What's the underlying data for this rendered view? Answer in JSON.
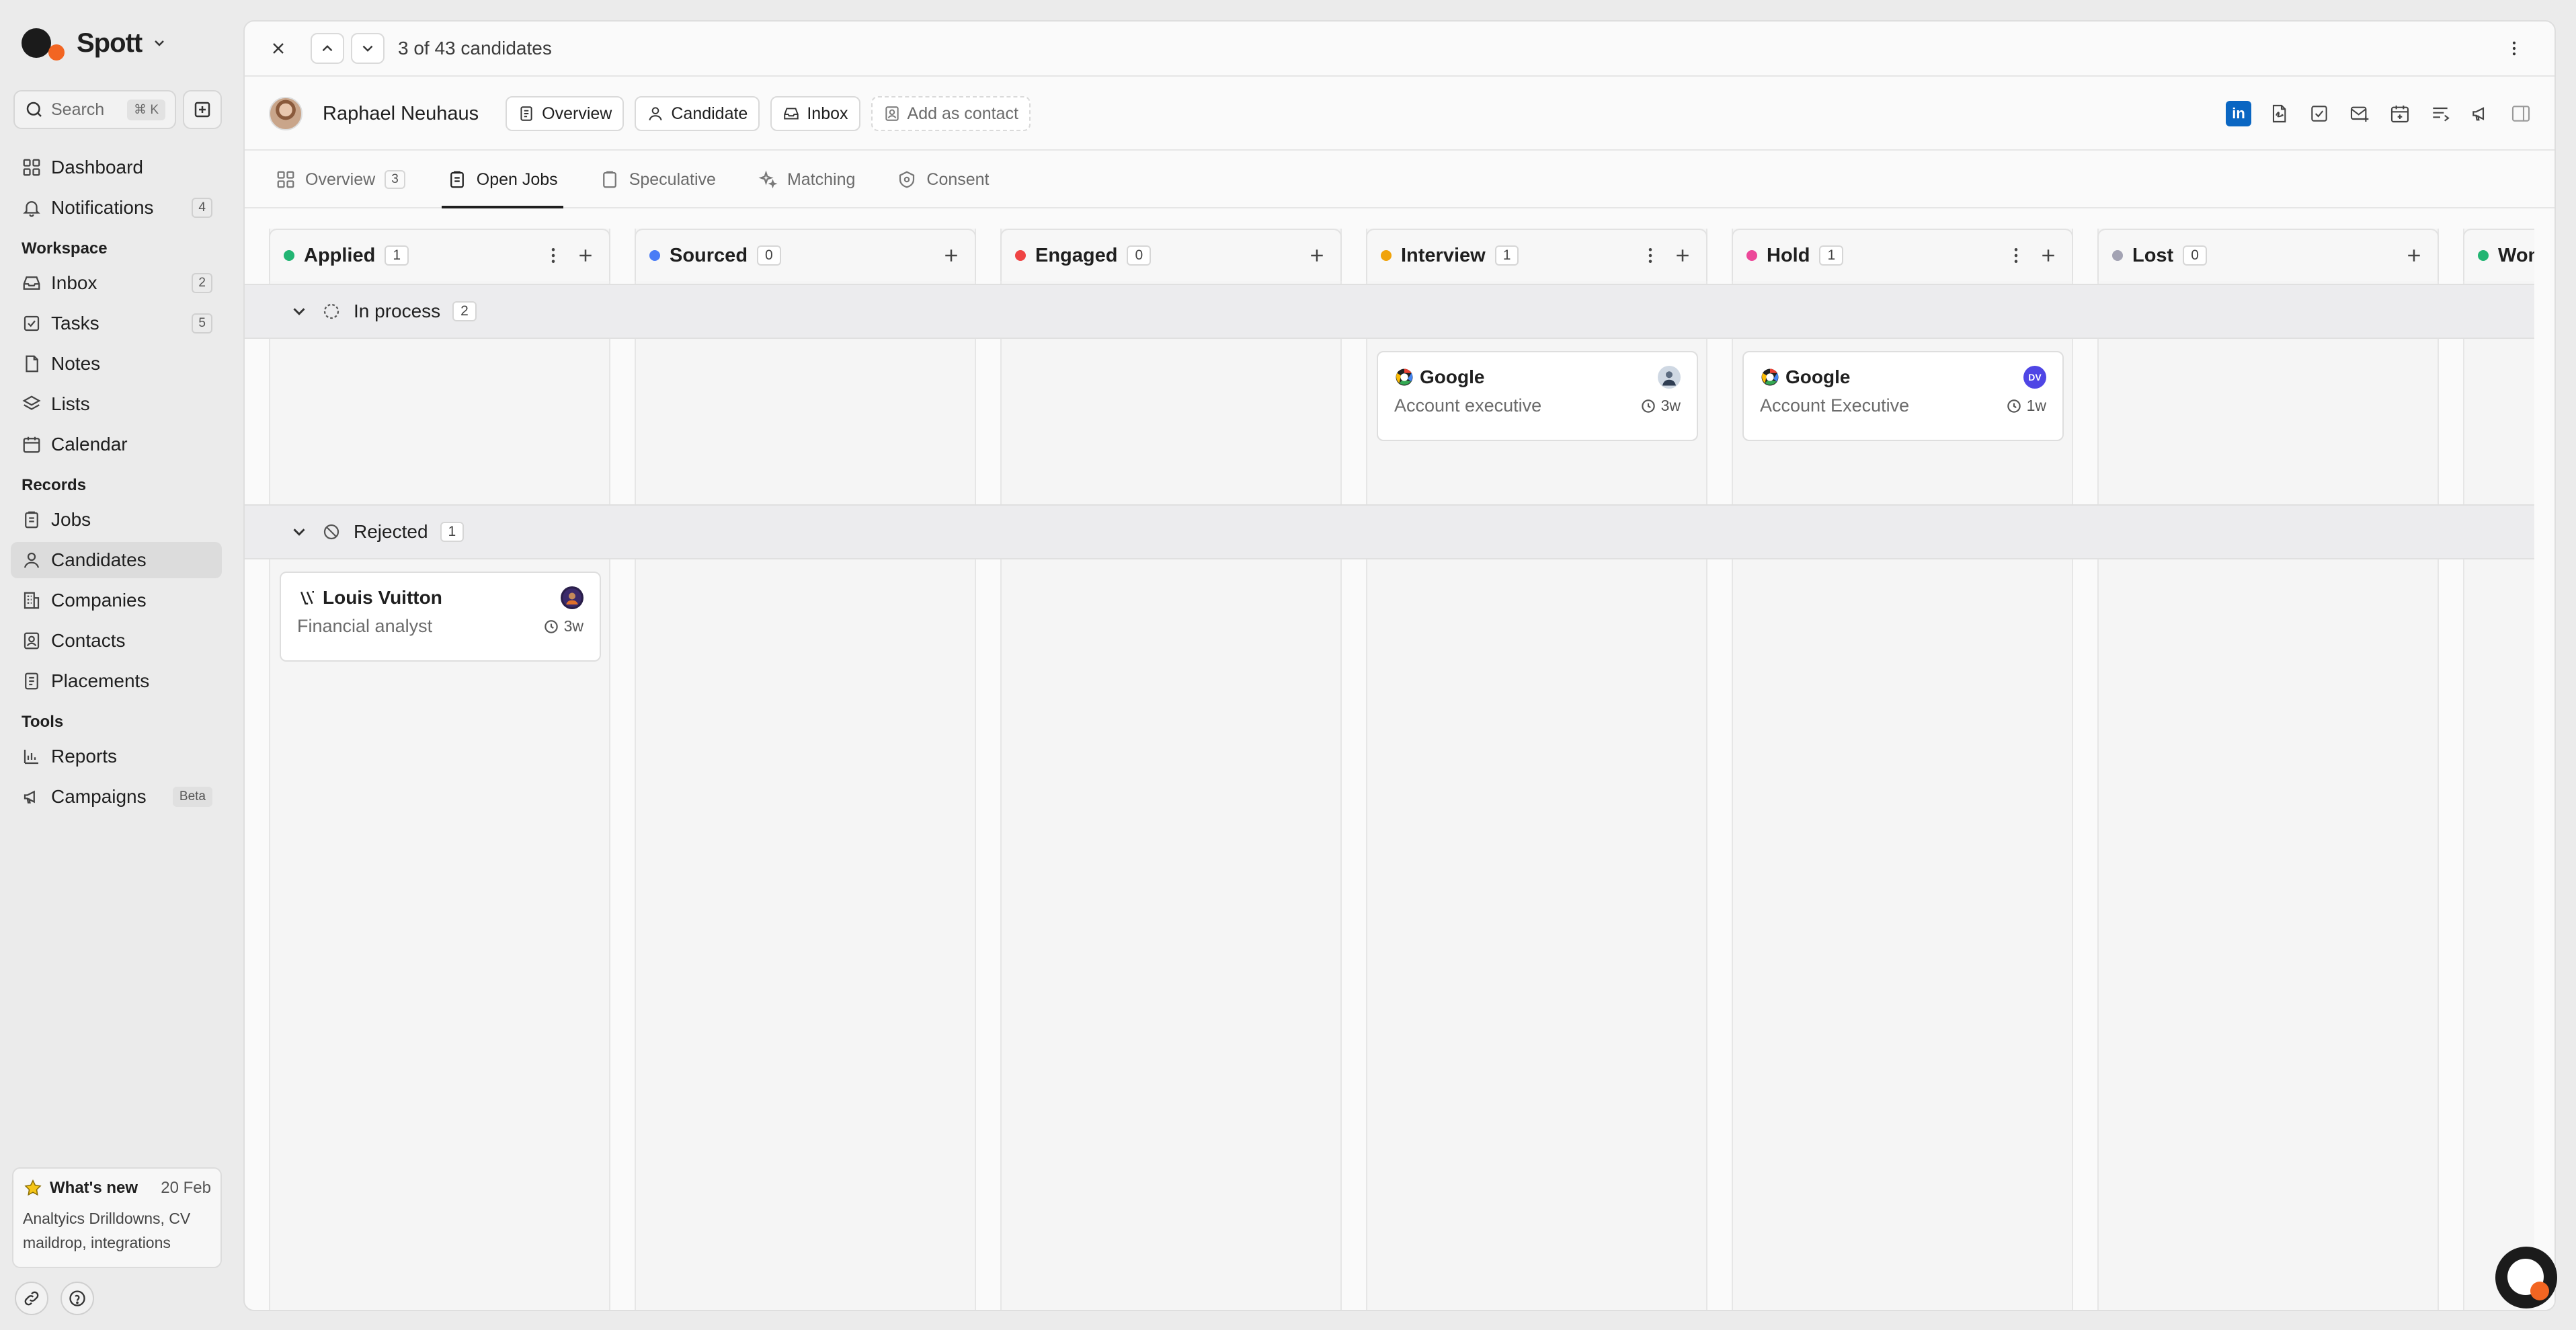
{
  "brand": {
    "name": "Spott"
  },
  "search": {
    "label": "Search",
    "shortcut": "⌘ K"
  },
  "sidebar": {
    "top_items": [
      {
        "label": "Dashboard"
      },
      {
        "label": "Notifications",
        "count": "4"
      }
    ],
    "workspace_title": "Workspace",
    "workspace_items": [
      {
        "label": "Inbox",
        "count": "2"
      },
      {
        "label": "Tasks",
        "count": "5"
      },
      {
        "label": "Notes"
      },
      {
        "label": "Lists"
      },
      {
        "label": "Calendar"
      }
    ],
    "records_title": "Records",
    "records_items": [
      {
        "label": "Jobs"
      },
      {
        "label": "Candidates"
      },
      {
        "label": "Companies"
      },
      {
        "label": "Contacts"
      },
      {
        "label": "Placements"
      }
    ],
    "tools_title": "Tools",
    "tools_items": [
      {
        "label": "Reports"
      },
      {
        "label": "Campaigns",
        "badge": "Beta"
      }
    ],
    "whats_new": {
      "title": "What's new",
      "date": "20 Feb",
      "body": "Analtyics Drilldowns, CV maildrop, integrations"
    }
  },
  "topbar": {
    "counter": "3 of 43 candidates"
  },
  "candidate": {
    "name": "Raphael  Neuhaus",
    "buttons": {
      "overview": "Overview",
      "candidate": "Candidate",
      "inbox": "Inbox",
      "add_contact": "Add as contact"
    },
    "linkedin": "in"
  },
  "tabs": [
    {
      "label": "Overview",
      "count": "3"
    },
    {
      "label": "Open Jobs"
    },
    {
      "label": "Speculative"
    },
    {
      "label": "Matching"
    },
    {
      "label": "Consent"
    }
  ],
  "columns": [
    {
      "title": "Applied",
      "count": "1",
      "color": "#22b573"
    },
    {
      "title": "Sourced",
      "count": "0",
      "color": "#4a7cf6"
    },
    {
      "title": "Engaged",
      "count": "0",
      "color": "#ef4444"
    },
    {
      "title": "Interview",
      "count": "1",
      "color": "#f0a30a"
    },
    {
      "title": "Hold",
      "count": "1",
      "color": "#ec4899"
    },
    {
      "title": "Lost",
      "count": "0",
      "color": "#a3a3b3"
    },
    {
      "title": "Won",
      "count": "",
      "color": "#22b573"
    }
  ],
  "groups": [
    {
      "label": "In process",
      "count": "2"
    },
    {
      "label": "Rejected",
      "count": "1"
    }
  ],
  "cards": [
    {
      "company": "Google",
      "role": "Account executive",
      "age": "3w",
      "avatar": ""
    },
    {
      "company": "Google",
      "role": "Account Executive",
      "age": "1w",
      "avatar": "DV"
    },
    {
      "company": "Louis Vuitton",
      "role": "Financial analyst",
      "age": "3w",
      "avatar": ""
    }
  ],
  "colors": {
    "accent": "#f26522",
    "linkedin": "#0a66c2",
    "avatar_dv": "#4f46e5"
  }
}
